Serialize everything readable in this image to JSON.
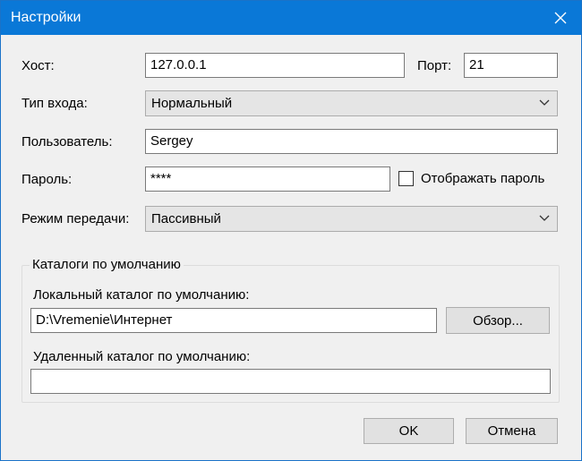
{
  "window": {
    "title": "Настройки"
  },
  "fields": {
    "host_label": "Хост:",
    "host_value": "127.0.0.1",
    "port_label": "Порт:",
    "port_value": "21",
    "login_type_label": "Тип входа:",
    "login_type_value": "Нормальный",
    "user_label": "Пользователь:",
    "user_value": "Sergey",
    "password_label": "Пароль:",
    "password_value": "****",
    "show_password_label": "Отображать пароль",
    "show_password_checked": false,
    "transfer_mode_label": "Режим передачи:",
    "transfer_mode_value": "Пассивный"
  },
  "defaults_group": {
    "title": "Каталоги по умолчанию",
    "local_label": "Локальный каталог по умолчанию:",
    "local_value": "D:\\Vremenie\\Интернет",
    "browse_label": "Обзор...",
    "remote_label": "Удаленный каталог по умолчанию:",
    "remote_value": ""
  },
  "buttons": {
    "ok": "OK",
    "cancel": "Отмена"
  },
  "icons": {
    "close": "close-icon",
    "dropdown": "chevron-down-icon"
  },
  "colors": {
    "titlebar": "#0a78d7",
    "background": "#f0f0f0"
  }
}
